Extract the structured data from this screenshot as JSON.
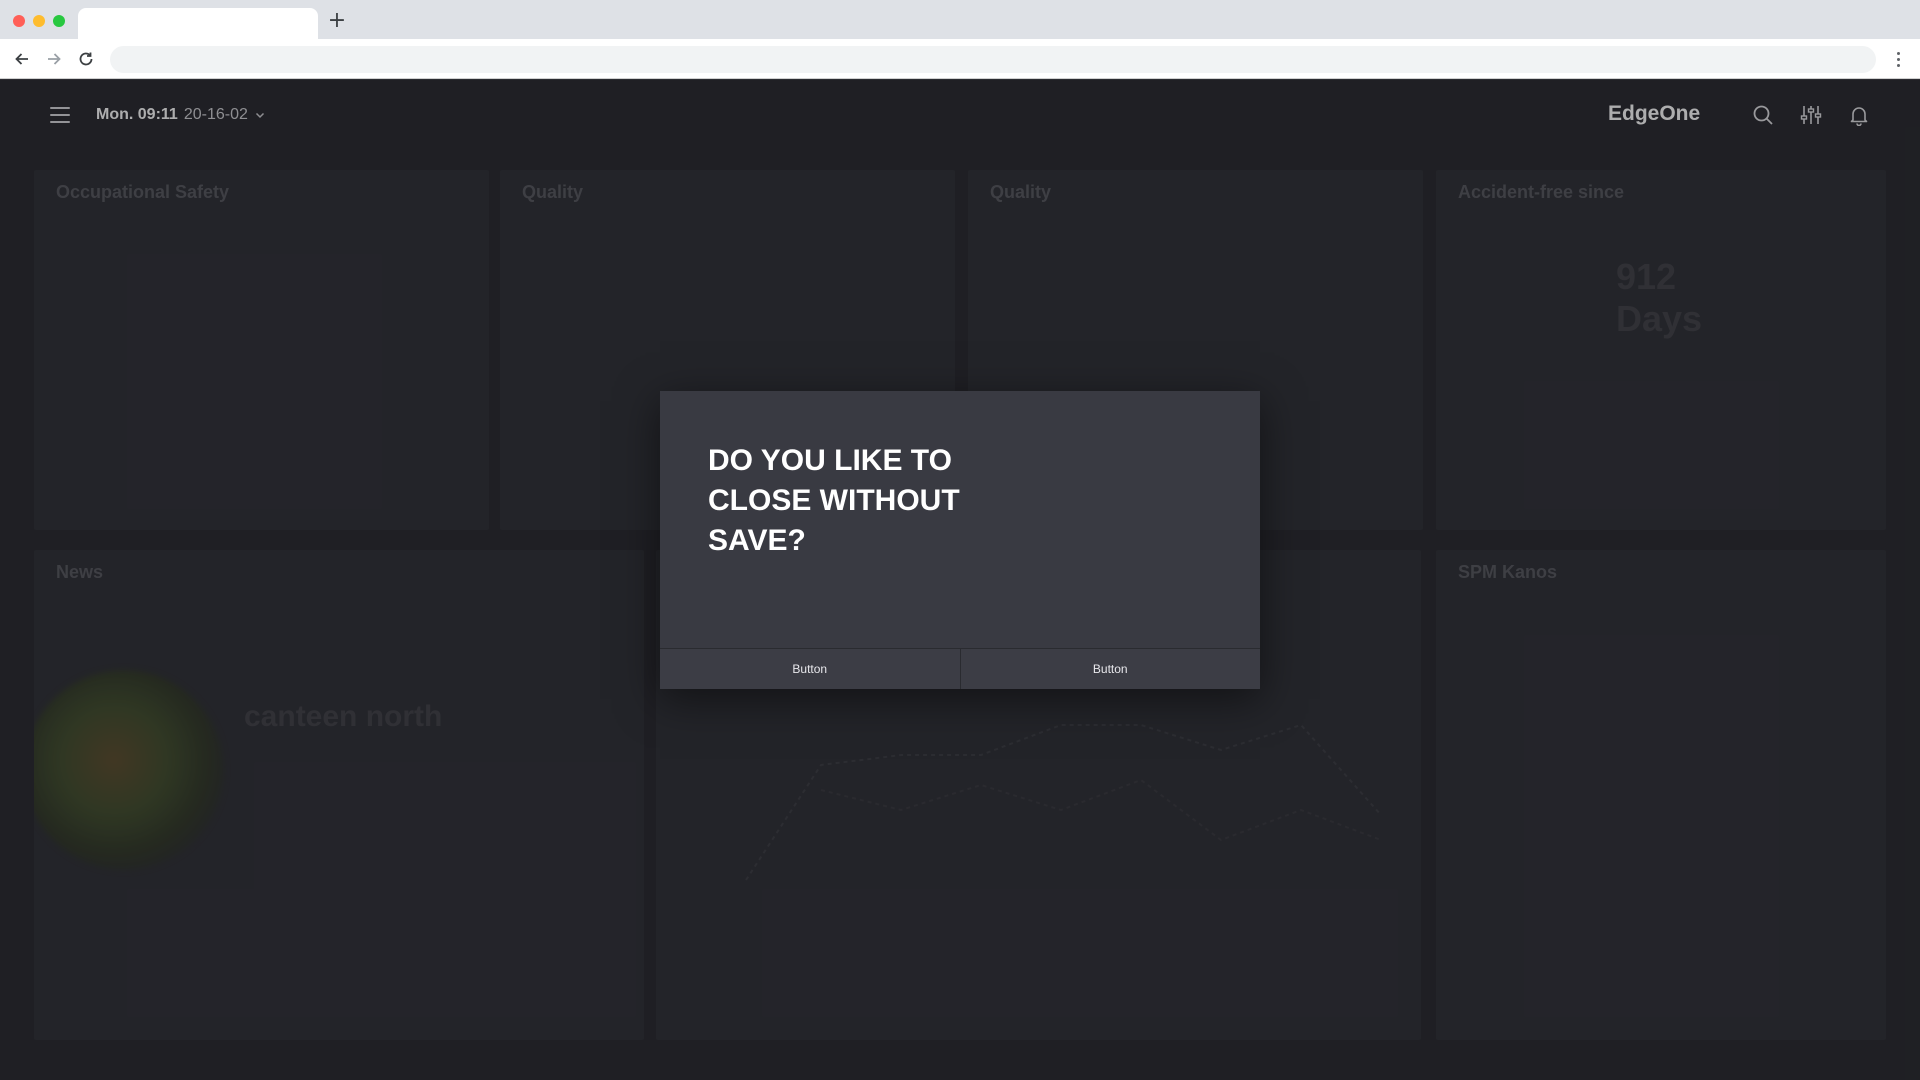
{
  "browser": {
    "traffic_lights": {
      "close": "#ff5f57",
      "minimize": "#febc2e",
      "maximize": "#28c840"
    },
    "new_tab_icon": "+"
  },
  "header": {
    "time": "Mon. 09:11",
    "date": "20-16-02",
    "brand": "EdgeOne"
  },
  "cards": {
    "safety_title": "Occupational Safety",
    "quality1_title": "Quality",
    "quality2_title": "Quality",
    "accident_title": "Accident-free since",
    "accident_value": "912",
    "accident_unit": "Days",
    "news_title": "News",
    "news_headline": "canteen north",
    "spm_title": "SPM Kanos"
  },
  "dialog": {
    "title": "DO YOU LIKE TO CLOSE WITHOUT SAVE?",
    "button_left": "Button",
    "button_right": "Button"
  },
  "colors": {
    "app_bg": "#25262b",
    "modal_bg": "#393a42",
    "text": "#ffffff"
  }
}
